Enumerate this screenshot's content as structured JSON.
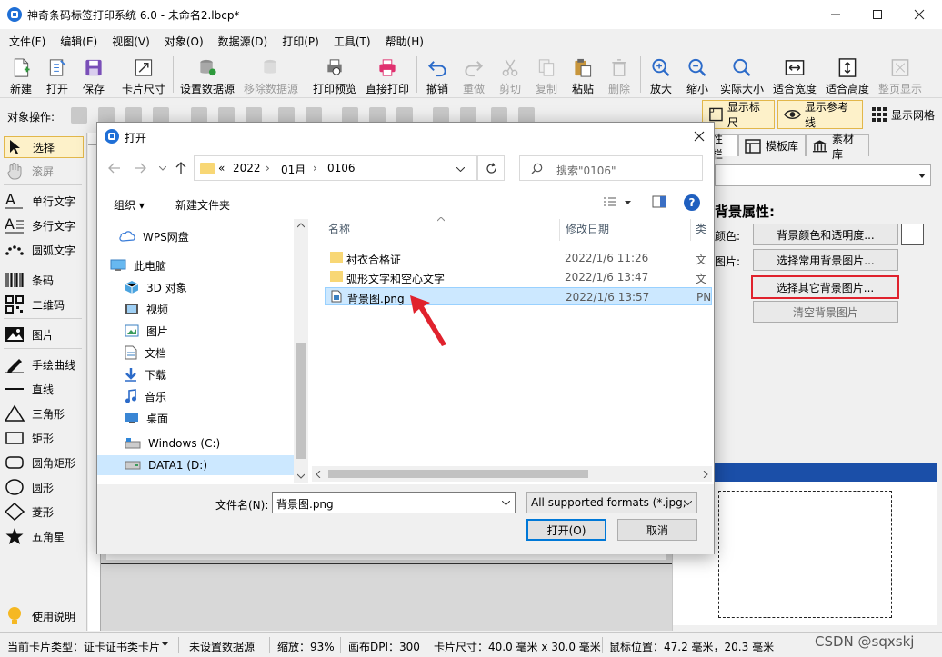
{
  "app": {
    "title": "神奇条码标签打印系统 6.0 - 未命名2.lbcp*",
    "watermark": "CSDN @sqxskj"
  },
  "menu": [
    "文件(F)",
    "编辑(E)",
    "视图(V)",
    "对象(O)",
    "数据源(D)",
    "打印(P)",
    "工具(T)",
    "帮助(H)"
  ],
  "toolbar": {
    "new": "新建",
    "open": "打开",
    "save": "保存",
    "card_size": "卡片尺寸",
    "set_datasource": "设置数据源",
    "remove_datasource": "移除数据源",
    "print_preview": "打印预览",
    "direct_print": "直接打印",
    "undo": "撤销",
    "redo": "重做",
    "cut": "剪切",
    "copy": "复制",
    "paste": "粘贴",
    "delete": "删除",
    "zoom_in": "放大",
    "zoom_out": "缩小",
    "actual_size": "实际大小",
    "fit_width": "适合宽度",
    "fit_height": "适合高度",
    "full_page": "整页显示"
  },
  "ops": {
    "label": "对象操作:",
    "show_ruler": "显示标尺",
    "show_guides": "显示参考线",
    "show_grid": "显示网格"
  },
  "tools": {
    "select": "选择",
    "scroll": "滚屏",
    "single_text": "单行文字",
    "multi_text": "多行文字",
    "arc_text": "圆弧文字",
    "barcode": "条码",
    "qrcode": "二维码",
    "image": "图片",
    "freehand": "手绘曲线",
    "line": "直线",
    "triangle": "三角形",
    "rect": "矩形",
    "round_rect": "圆角矩形",
    "circle": "圆形",
    "diamond": "菱形",
    "star": "五角星",
    "help": "使用说明"
  },
  "right_panel": {
    "tabs": [
      "性栏",
      "模板库",
      "素材库"
    ],
    "section_title": "背景属性:",
    "color_label": "颜色:",
    "image_label": "图片:",
    "btn_color": "背景颜色和透明度...",
    "btn_common": "选择常用背景图片...",
    "btn_other": "选择其它背景图片...",
    "btn_clear": "清空背景图片"
  },
  "status": {
    "card_type": "当前卡片类型：证卡证书类卡片",
    "datasource": "未设置数据源",
    "zoom": "缩放：93%",
    "dpi": "画布DPI：300",
    "card_size": "卡片尺寸：40.0 毫米 x 30.0 毫米",
    "mouse": "鼠标位置：47.2 毫米，20.3 毫米"
  },
  "dialog": {
    "title": "打开",
    "breadcrumb": [
      "«",
      "2022",
      "01月",
      "0106"
    ],
    "search_placeholder": "搜索\"0106\"",
    "organize": "组织 ▾",
    "new_folder": "新建文件夹",
    "nav": [
      "WPS网盘",
      "此电脑",
      "3D 对象",
      "视频",
      "图片",
      "文档",
      "下载",
      "音乐",
      "桌面",
      "Windows (C:)",
      "DATA1 (D:)"
    ],
    "columns": {
      "name": "名称",
      "date": "修改日期",
      "type": "类"
    },
    "files": [
      {
        "name": "衬衣合格证",
        "date": "2022/1/6 11:26",
        "type": "文"
      },
      {
        "name": "弧形文字和空心文字",
        "date": "2022/1/6 13:47",
        "type": "文"
      },
      {
        "name": "背景图.png",
        "date": "2022/1/6 13:57",
        "type": "PN"
      }
    ],
    "filename_label": "文件名(N):",
    "filename_value": "背景图.png",
    "filter_value": "All supported formats (*.jpg;",
    "open_btn": "打开(O)",
    "cancel_btn": "取消"
  },
  "colors": {
    "accent_red": "#e0222d",
    "selection_blue": "#cce8ff",
    "toggle_on": "#fdf1c9"
  }
}
